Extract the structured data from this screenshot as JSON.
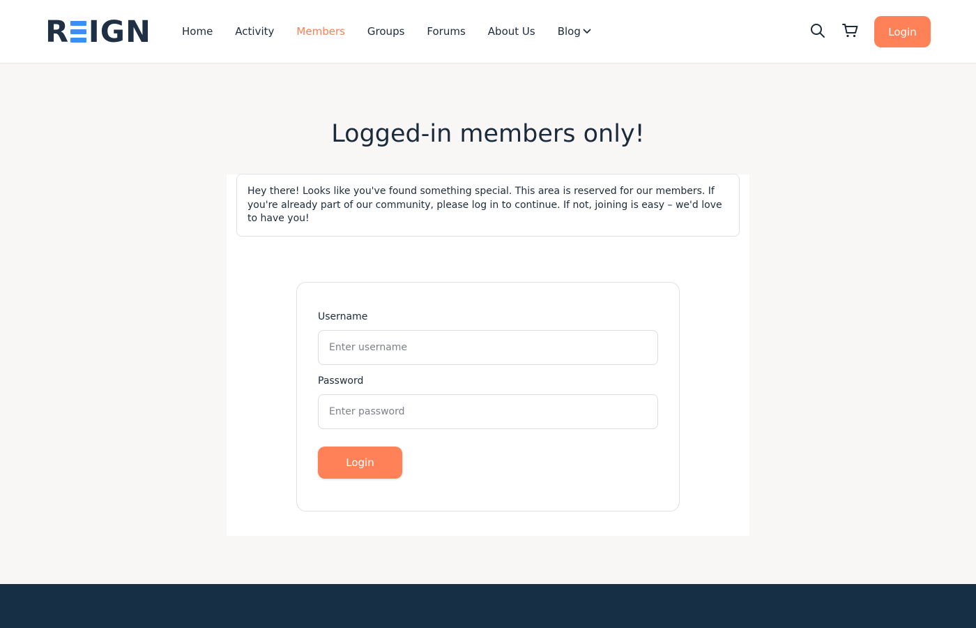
{
  "brand": {
    "logo_text_left": "R",
    "logo_text_right": "IGN",
    "logo_accent_color": "#3b8ef3",
    "logo_color": "#1f3045"
  },
  "nav": {
    "items": [
      {
        "label": "Home",
        "active": false
      },
      {
        "label": "Activity",
        "active": false
      },
      {
        "label": "Members",
        "active": true
      },
      {
        "label": "Groups",
        "active": false
      },
      {
        "label": "Forums",
        "active": false
      },
      {
        "label": "About Us",
        "active": false
      },
      {
        "label": "Blog",
        "active": false,
        "has_dropdown": true
      }
    ],
    "active_color": "#ff7e55"
  },
  "header": {
    "search_icon": "search-icon",
    "cart_icon": "cart-icon",
    "login_label": "Login"
  },
  "main": {
    "title": "Logged-in members only!",
    "notice": "Hey there! Looks like you've found something special. This area is reserved for our members. If you're already part of our community, please log in to continue. If not, joining is easy – we'd love to have you!",
    "form": {
      "username_label": "Username",
      "username_placeholder": "Enter username",
      "password_label": "Password",
      "password_placeholder": "Enter password",
      "submit_label": "Login"
    }
  },
  "colors": {
    "accent": "#ff8157",
    "footer": "#172f45",
    "page_bg": "#f8f7f5"
  }
}
